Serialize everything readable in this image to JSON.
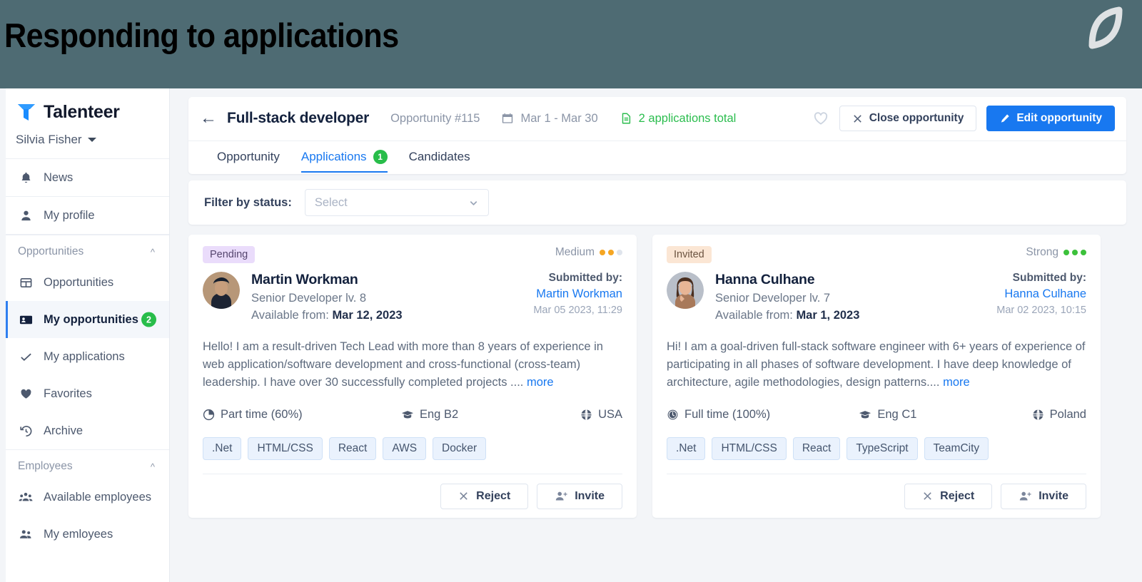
{
  "banner": {
    "title": "Responding to applications",
    "logo_icon": "leaf-logo-icon",
    "bg": "#4e6b73"
  },
  "sidebar": {
    "brand": "Talenteer",
    "brand_icon": "talenteer-t-logo-icon",
    "user": "Silvia Fisher",
    "top_items": [
      {
        "label": "News",
        "icon": "bell-icon"
      },
      {
        "label": "My profile",
        "icon": "person-icon"
      }
    ],
    "groups": [
      {
        "label": "Opportunities",
        "collapse_icon": "chevron-up-icon",
        "items": [
          {
            "label": "Opportunities",
            "icon": "grid-icon",
            "active": false,
            "badge": ""
          },
          {
            "label": "My opportunities",
            "icon": "id-card-icon",
            "active": true,
            "badge": "2"
          },
          {
            "label": "My applications",
            "icon": "check-icon",
            "active": false,
            "badge": ""
          },
          {
            "label": "Favorites",
            "icon": "heart-filled-icon",
            "active": false,
            "badge": ""
          },
          {
            "label": "Archive",
            "icon": "history-icon",
            "active": false,
            "badge": ""
          }
        ]
      },
      {
        "label": "Employees",
        "collapse_icon": "chevron-up-icon",
        "items": [
          {
            "label": "Available employees",
            "icon": "people-group-icon",
            "active": false,
            "badge": ""
          },
          {
            "label": "My emloyees",
            "icon": "people-icon",
            "active": false,
            "badge": ""
          }
        ]
      }
    ],
    "accent": "#2f7ff0",
    "badge_color": "#28bd4a"
  },
  "toolbar": {
    "back_icon": "arrow-left-icon",
    "title": "Full-stack developer",
    "opportunity_id": "Opportunity #115",
    "date_icon": "calendar-icon",
    "date_range": "Mar 1 - Mar 30",
    "applications_icon": "document-icon",
    "applications_total": "2 applications total",
    "applications_color": "#2bbd4e",
    "favorite_icon": "heart-outline-icon",
    "close_label": "Close opportunity",
    "close_icon": "close-x-icon",
    "edit_label": "Edit opportunity",
    "edit_icon": "pencil-icon",
    "primary_color": "#1878f0"
  },
  "tabs": [
    {
      "label": "Opportunity",
      "active": false,
      "badge": ""
    },
    {
      "label": "Applications",
      "active": true,
      "badge": "1"
    },
    {
      "label": "Candidates",
      "active": false,
      "badge": ""
    }
  ],
  "filter": {
    "label": "Filter by status:",
    "value": "",
    "placeholder": "Select",
    "chevron_icon": "chevron-down-icon"
  },
  "cards": [
    {
      "status": "Pending",
      "status_style": "pending",
      "rating_label": "Medium",
      "rating_filled": 2,
      "rating_total": 3,
      "rating_color": "#f5a623",
      "avatar_icon": "avatar-martin",
      "name": "Martin Workman",
      "role": "Senior Developer lv. 8",
      "available_label": "Available from:",
      "available_value": "Mar 12, 2023",
      "submitted_label": "Submitted by:",
      "submitted_by": "Martin Workman",
      "submitted_date": "Mar 05 2023, 11:29",
      "bio": "Hello! I am a result-driven Tech Lead with more than 8 years of experience in web application/software development and cross-functional (cross-team) leadership. I have over 30 successfully completed projects ....",
      "more_label": "more",
      "employment_icon": "clock-part-time-icon",
      "employment": "Part time (60%)",
      "language_icon": "graduation-cap-icon",
      "language": "Eng B2",
      "location_icon": "globe-icon",
      "location": "USA",
      "tags": [
        ".Net",
        "HTML/CSS",
        "React",
        "AWS",
        "Docker"
      ],
      "reject_label": "Reject",
      "reject_icon": "close-x-icon",
      "invite_label": "Invite",
      "invite_icon": "person-add-icon"
    },
    {
      "status": "Invited",
      "status_style": "invited",
      "rating_label": "Strong",
      "rating_filled": 3,
      "rating_total": 3,
      "rating_color": "#3cc13b",
      "avatar_icon": "avatar-hanna",
      "name": "Hanna Culhane",
      "role": "Senior Developer lv. 7",
      "available_label": "Available from:",
      "available_value": "Mar 1, 2023",
      "submitted_label": "Submitted by:",
      "submitted_by": "Hanna Culhane",
      "submitted_date": "Mar 02 2023, 10:15",
      "bio": "Hi! I am a goal-driven full-stack software engineer with 6+ years of experience of participating in all phases of software development. I have deep knowledge of architecture, agile methodologies, design patterns....",
      "more_label": "more",
      "employment_icon": "clock-full-time-icon",
      "employment": "Full time (100%)",
      "language_icon": "graduation-cap-icon",
      "language": "Eng C1",
      "location_icon": "globe-icon",
      "location": "Poland",
      "tags": [
        ".Net",
        "HTML/CSS",
        "React",
        "TypeScript",
        "TeamCity"
      ],
      "reject_label": "Reject",
      "reject_icon": "close-x-icon",
      "invite_label": "Invite",
      "invite_icon": "person-add-icon"
    }
  ]
}
